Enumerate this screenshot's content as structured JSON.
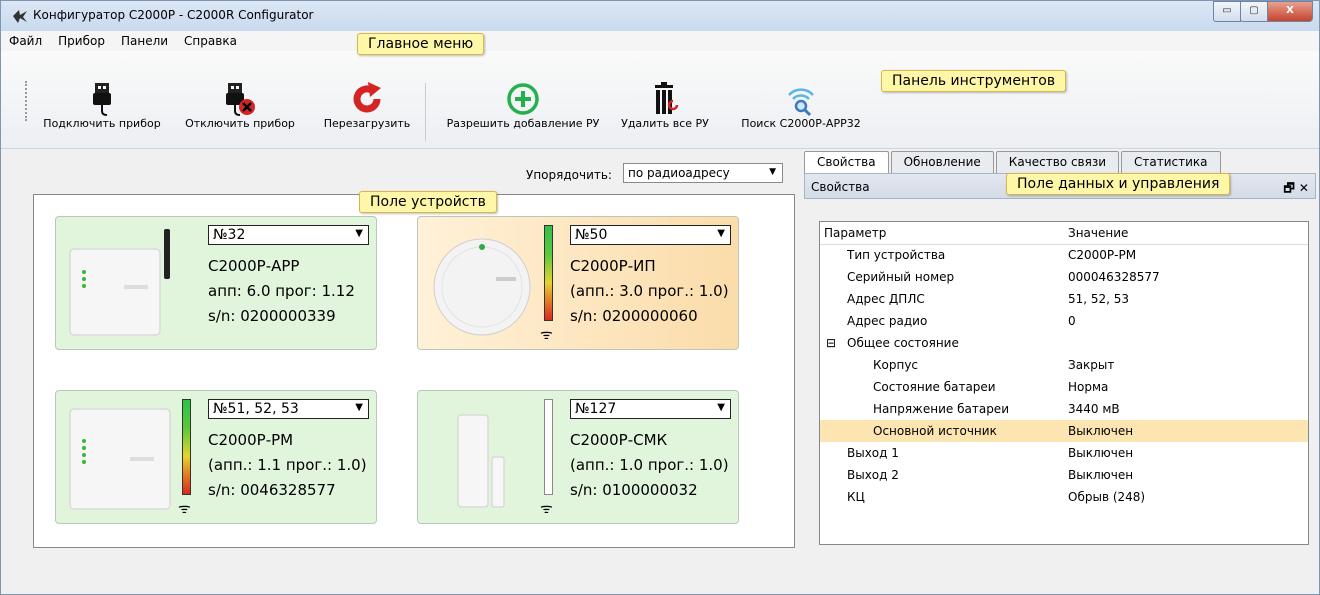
{
  "window": {
    "title": "Конфигуратор C2000P - C2000R Configurator",
    "buttons": {
      "minimize": "▭",
      "maximize": "▢",
      "close": "X"
    }
  },
  "menu": [
    "Файл",
    "Прибор",
    "Панели",
    "Справка"
  ],
  "toolbar": {
    "connect": "Подключить прибор",
    "disconnect": "Отключить прибор",
    "reboot": "Перезагрузить",
    "allow_add": "Разрешить добавление РУ",
    "delete_all": "Удалить все РУ",
    "search": "Поиск С2000Р-АРР32"
  },
  "callouts": {
    "main_menu": "Главное меню",
    "toolbar": "Панель инструментов",
    "device_field": "Поле устройств",
    "data_field": "Поле данных и управления"
  },
  "sort": {
    "label": "Упорядочить:",
    "value": "по радиоадресу"
  },
  "devices": [
    {
      "address": "№32",
      "name": "С2000Р-АРР",
      "version": "апп: 6.0 прог: 1.12",
      "serial": "s/n: 0200000339"
    },
    {
      "address": "№50",
      "name": "С2000Р-ИП",
      "version": "(апп.: 3.0 прог.: 1.0)",
      "serial": "s/n: 0200000060"
    },
    {
      "address": "№51, 52, 53",
      "name": "С2000Р-РМ",
      "version": "(апп.: 1.1 прог.: 1.0)",
      "serial": "s/n: 0046328577"
    },
    {
      "address": "№127",
      "name": "С2000Р-СМК",
      "version": "(апп.: 1.0 прог.: 1.0)",
      "serial": "s/n: 0100000032"
    }
  ],
  "tabs": [
    "Свойства",
    "Обновление",
    "Качество связи",
    "Статистика"
  ],
  "panel": {
    "title": "Свойства",
    "controls": "🗗 ✕"
  },
  "properties": {
    "col_param": "Параметр",
    "col_value": "Значение",
    "rows": [
      {
        "param": "Тип устройства",
        "value": "С2000Р-РМ"
      },
      {
        "param": "Серийный номер",
        "value": "000046328577"
      },
      {
        "param": "Адрес ДПЛС",
        "value": "51, 52, 53"
      },
      {
        "param": "Адрес радио",
        "value": "0"
      },
      {
        "param": "Общее состояние",
        "value": ""
      },
      {
        "param": "Корпус",
        "value": "Закрыт"
      },
      {
        "param": "Состояние батареи",
        "value": "Норма"
      },
      {
        "param": "Напряжение батареи",
        "value": "3440 мВ"
      },
      {
        "param": "Основной источник",
        "value": "Выключен"
      },
      {
        "param": "Выход 1",
        "value": "Выключен"
      },
      {
        "param": "Выход 2",
        "value": "Выключен"
      },
      {
        "param": "КЦ",
        "value": "Обрыв (248)"
      }
    ],
    "collapse_glyph": "⊟"
  },
  "colors": {
    "card_green": "#e0f5dc",
    "card_orange": "#fbdcaa",
    "selected_row": "#fce5b0",
    "reboot": "#d42424",
    "add": "#22b14c"
  }
}
